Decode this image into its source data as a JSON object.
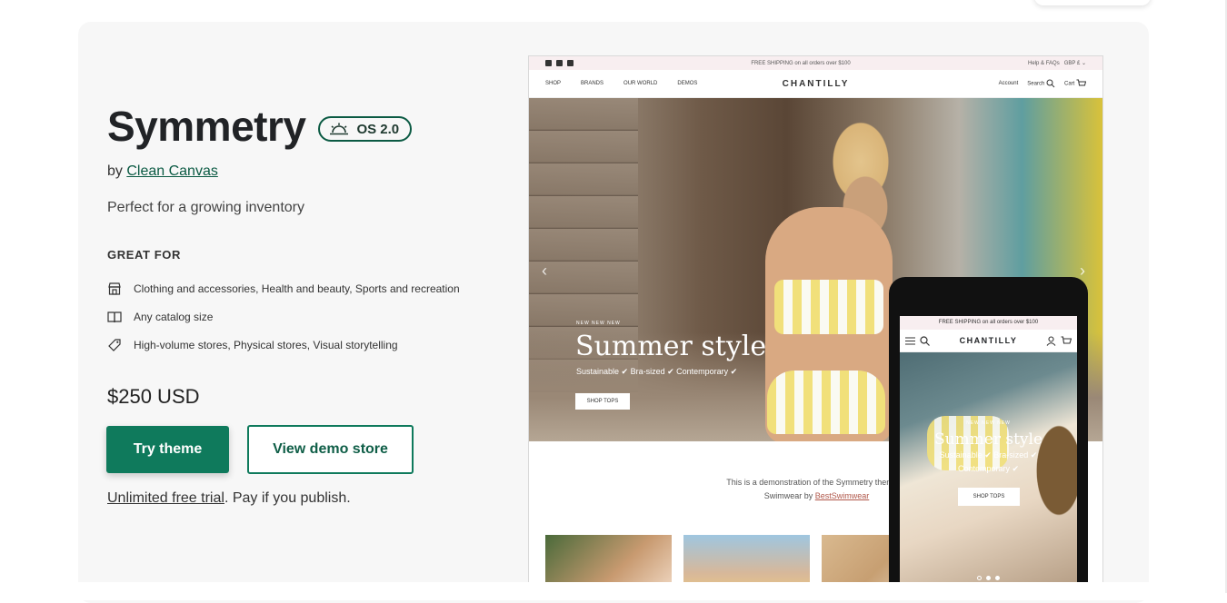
{
  "theme": {
    "title": "Symmetry",
    "os_badge": "OS 2.0",
    "by_prefix": "by ",
    "author": "Clean Canvas",
    "tagline": "Perfect for a growing inventory",
    "great_for_heading": "GREAT FOR",
    "features": [
      {
        "icon": "store-icon",
        "text": "Clothing and accessories, Health and beauty, Sports and recreation"
      },
      {
        "icon": "book-icon",
        "text": "Any catalog size"
      },
      {
        "icon": "tag-icon",
        "text": "High-volume stores, Physical stores, Visual storytelling"
      }
    ],
    "price": "$250 USD",
    "try_button": "Try theme",
    "demo_button": "View demo store",
    "trial_link": "Unlimited free trial",
    "trial_suffix": ". Pay if you publish."
  },
  "preview": {
    "announcement": "FREE SHIPPING on all orders over $100",
    "help": "Help & FAQs",
    "currency": "GBP £",
    "nav": [
      "SHOP",
      "BRANDS",
      "OUR WORLD",
      "DEMOS"
    ],
    "logo": "CHANTILLY",
    "account": "Account",
    "search": "Search",
    "cart": "Cart",
    "hero_kicker": "NEW NEW NEW",
    "hero_title": "Summer style",
    "hero_sub": "Sustainable ✔ Bra-sized ✔ Contemporary ✔",
    "hero_button": "SHOP TOPS",
    "demo_line1": "This is a demonstration of the Symmetry theme fo",
    "demo_line2_prefix": "Swimwear by ",
    "demo_link": "BestSwimwear"
  },
  "phone": {
    "announcement": "FREE SHIPPING on all orders over $100",
    "logo": "CHANTILLY",
    "hero_kicker": "NEW NEW NEW",
    "hero_title": "Summer style",
    "hero_sub_line1": "Sustainable ✔ Bra-sized ✔",
    "hero_sub_line2": "Contemporary ✔",
    "hero_button": "SHOP TOPS"
  },
  "colors": {
    "accent": "#0f7a5c",
    "badge_border": "#0b5a43",
    "panel": "#f7f7f7",
    "announcement_bg": "#f8eef0"
  }
}
